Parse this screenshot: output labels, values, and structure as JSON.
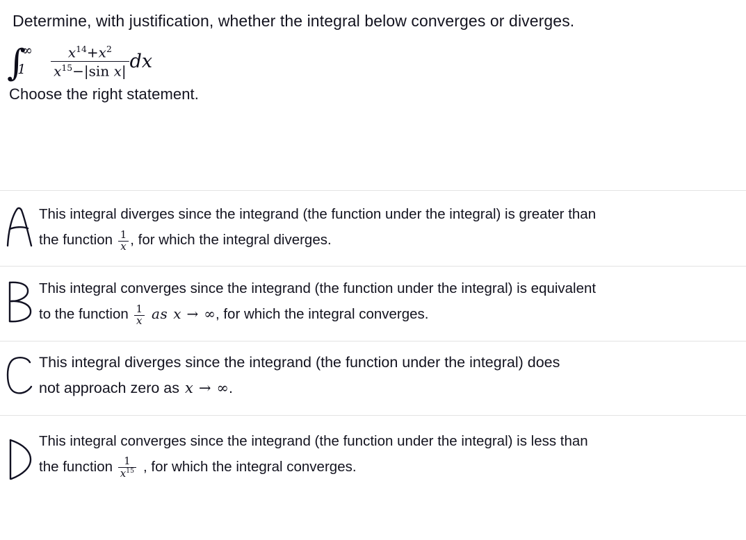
{
  "question": {
    "prompt": "Determine, with justification, whether the integral below converges or diverges.",
    "instruction": "Choose the right statement.",
    "formula": {
      "integral_lower_limit": "1",
      "integral_upper_limit": "∞",
      "numerator_base": "x",
      "numerator_exp1": "14",
      "numerator_plus": "+",
      "numerator_base2": "x",
      "numerator_exp2": "2",
      "denominator_base": "x",
      "denominator_exp": "15",
      "denominator_minus": "−",
      "denominator_abs_open": "|",
      "denominator_sin": "sin",
      "denominator_sin_arg": "x",
      "denominator_abs_close": "|",
      "differential": "dx",
      "plain_text": "∫₁^∞ (x^14 + x^2) / (x^15 − |sin x|) dx"
    }
  },
  "options": [
    {
      "letter": "A",
      "line1": "This integral diverges since the integrand (the function under the integral) is greater than",
      "line2_before": "the function",
      "frac_num": "1",
      "frac_den": "x",
      "line2_after": ", for which the integral diverges.",
      "plain_text": "This integral diverges since the integrand (the function under the integral) is greater than the function 1/x, for which the integral diverges."
    },
    {
      "letter": "B",
      "line1": "This integral converges since the integrand (the function under the integral) is equivalent",
      "line2_before": "to the function",
      "frac_num": "1",
      "frac_den": "x",
      "as_word": "as",
      "var": "x",
      "arrow": "→",
      "limit": "∞",
      "line2_after": ", for which the integral converges.",
      "plain_text": "This integral converges since the integrand (the function under the integral) is equivalent to the function 1/x as x → ∞, for which the integral converges."
    },
    {
      "letter": "C",
      "line1": "This integral diverges since the integrand (the function under the integral) does",
      "line2_before": "not approach zero as",
      "var": "x",
      "arrow": "→",
      "limit": "∞",
      "line2_after": ".",
      "plain_text": "This integral diverges since the integrand (the function under the integral) does not approach zero as x → ∞."
    },
    {
      "letter": "D",
      "line1": "This integral converges since the integrand (the function under the integral) is less   than",
      "line2_before": "the function",
      "frac_num": "1",
      "frac_den_base": "x",
      "frac_den_exp": "15",
      "line2_after": ", for which the integral converges.",
      "plain_text": "This integral converges since the integrand (the function under the integral) is less than the function 1/x^15, for which the integral converges."
    }
  ],
  "colors": {
    "text": "#13131f",
    "math": "#111122",
    "separator": "#e3e3e3",
    "background": "#ffffff"
  }
}
